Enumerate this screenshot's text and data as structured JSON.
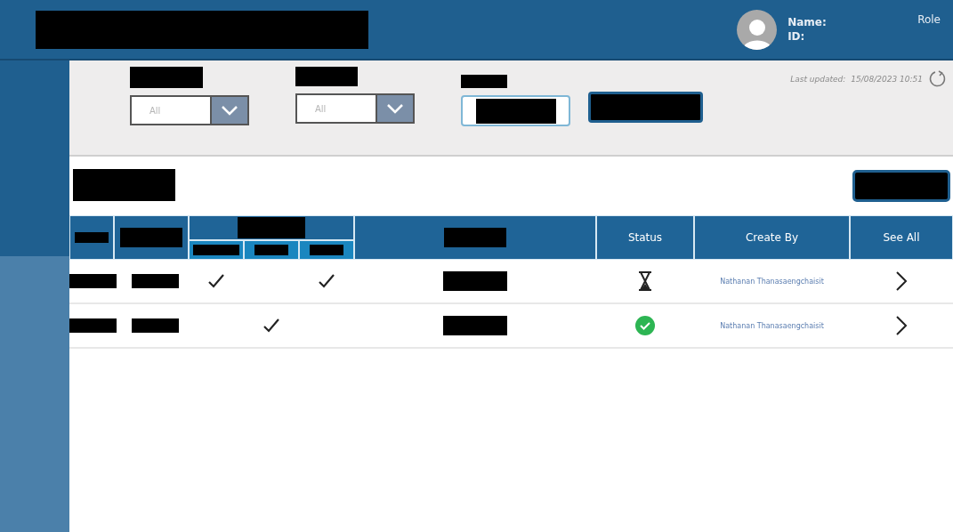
{
  "header": {
    "name_label": "Name:",
    "id_label": "ID:",
    "role": "Role"
  },
  "filters": {
    "dropdowns": [
      {
        "value": "All"
      },
      {
        "value": "All"
      }
    ],
    "last_updated_label": "Last updated:",
    "last_updated": "15/08/2023 10:51"
  },
  "table": {
    "columns": [
      "Status",
      "Create By",
      "See All"
    ],
    "rows": [
      {
        "checks": [
          true,
          false,
          true
        ],
        "status": {
          "kind": "pending"
        },
        "created_by": "Nathanan Thanasaengchaisit"
      },
      {
        "checks": [
          false,
          true,
          false
        ],
        "status": {
          "kind": "done"
        },
        "created_by": "Nathanan Thanasaengchaisit"
      }
    ]
  }
}
